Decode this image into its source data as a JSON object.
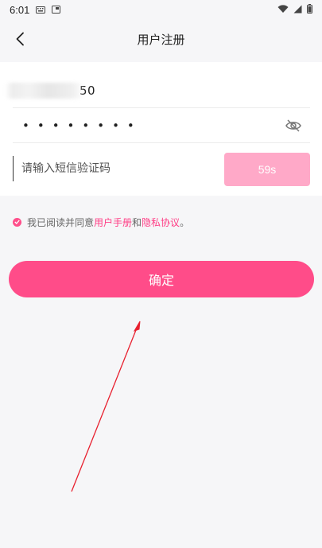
{
  "status_bar": {
    "time": "6:01"
  },
  "header": {
    "title": "用户注册"
  },
  "form": {
    "phone_visible_suffix": "50",
    "password_masked": "••••••••",
    "code_placeholder": "请输入短信验证码",
    "sms_button_label": "59s"
  },
  "agreement": {
    "prefix": "我已阅读并同意",
    "user_manual_link": "用户手册",
    "conjunction": "和",
    "privacy_link": "隐私协议",
    "suffix": "。"
  },
  "confirm_button_label": "确定",
  "colors": {
    "accent": "#ff4c89",
    "link": "#ff3d85",
    "sms_button_disabled": "#ffa9c8",
    "annotation_arrow": "#e8202f"
  }
}
